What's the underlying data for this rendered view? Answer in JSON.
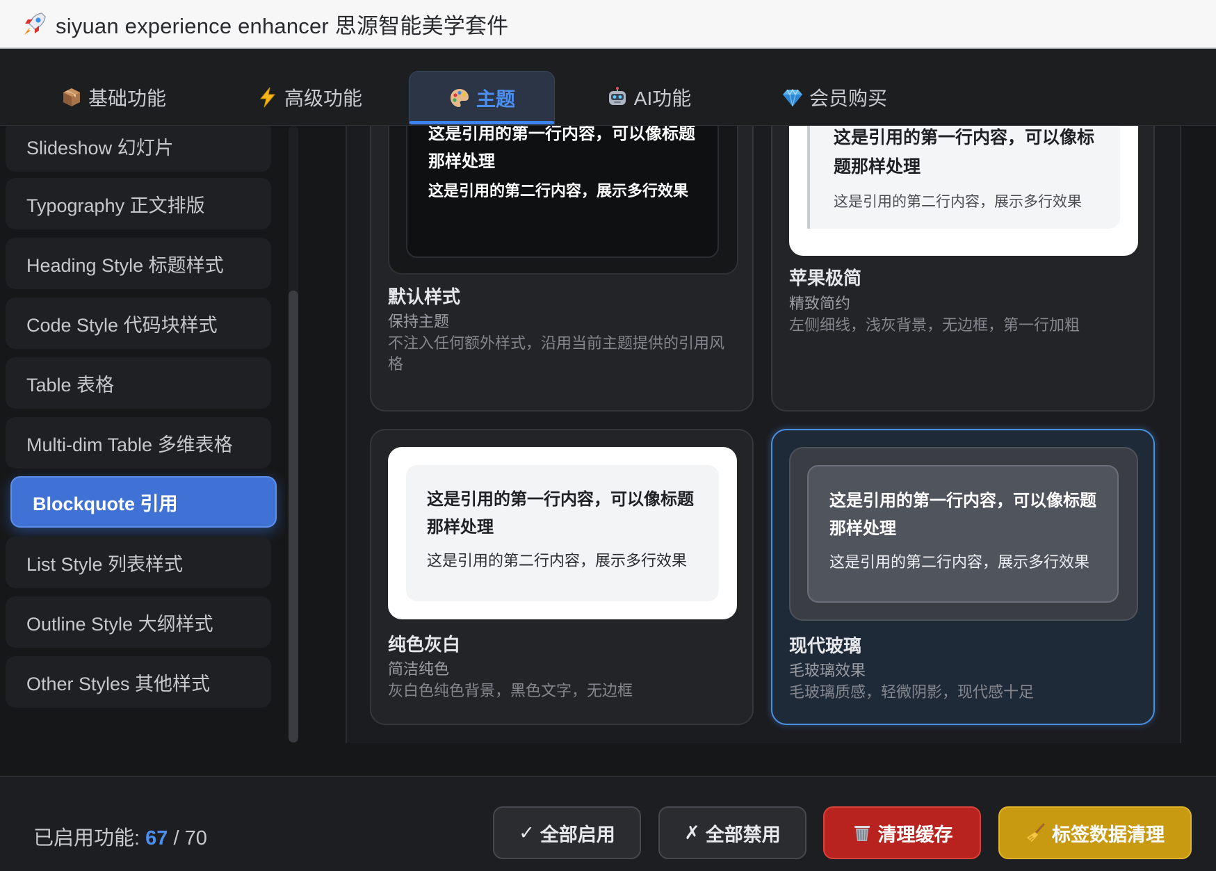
{
  "window": {
    "title": "siyuan experience enhancer 思源智能美学套件",
    "icon": "rocket-icon"
  },
  "tabs": [
    {
      "label": "基础功能",
      "icon": "package-icon",
      "active": false
    },
    {
      "label": "高级功能",
      "icon": "lightning-icon",
      "active": false
    },
    {
      "label": "主题",
      "icon": "palette-icon",
      "active": true
    },
    {
      "label": "AI功能",
      "icon": "robot-icon",
      "active": false
    },
    {
      "label": "会员购买",
      "icon": "diamond-icon",
      "active": false
    }
  ],
  "sidebar": {
    "items": [
      {
        "label": "Slideshow 幻灯片"
      },
      {
        "label": "Typography 正文排版"
      },
      {
        "label": "Heading Style 标题样式"
      },
      {
        "label": "Code Style 代码块样式"
      },
      {
        "label": "Table 表格"
      },
      {
        "label": "Multi-dim Table 多维表格"
      },
      {
        "label": "Blockquote 引用",
        "active": true
      },
      {
        "label": "List Style 列表样式"
      },
      {
        "label": "Outline Style 大纲样式"
      },
      {
        "label": "Other Styles 其他样式"
      }
    ]
  },
  "styles": [
    {
      "name": "默认样式",
      "subtitle": "保持主题",
      "description": "不注入任何额外样式，沿用当前主题提供的引用风格",
      "quote_line1": "这是引用的第一行内容，可以像标题那样处理",
      "quote_line2": "这是引用的第二行内容，展示多行效果",
      "selected": false
    },
    {
      "name": "苹果极简",
      "subtitle": "精致简约",
      "description": "左侧细线，浅灰背景，无边框，第一行加粗",
      "quote_line1": "这是引用的第一行内容，可以像标题那样处理",
      "quote_line2": "这是引用的第二行内容，展示多行效果",
      "selected": false
    },
    {
      "name": "纯色灰白",
      "subtitle": "简洁纯色",
      "description": "灰白色纯色背景，黑色文字，无边框",
      "quote_line1": "这是引用的第一行内容，可以像标题那样处理",
      "quote_line2": "这是引用的第二行内容，展示多行效果",
      "selected": false
    },
    {
      "name": "现代玻璃",
      "subtitle": "毛玻璃效果",
      "description": "毛玻璃质感，轻微阴影，现代感十足",
      "quote_line1": "这是引用的第一行内容，可以像标题那样处理",
      "quote_line2": "这是引用的第二行内容，展示多行效果",
      "selected": true
    }
  ],
  "footer": {
    "enabled_label": "已启用功能: ",
    "enabled_count": "67",
    "separator": " / ",
    "total_count": "70",
    "buttons": {
      "enable_all": "全部启用",
      "enable_all_icon": "✓",
      "disable_all": "全部禁用",
      "disable_all_icon": "✗",
      "clear_cache": "清理缓存",
      "clear_cache_icon": "wastebasket-icon",
      "tag_cleanup": "标签数据清理",
      "tag_cleanup_icon": "broom-icon"
    }
  },
  "colors": {
    "accent": "#3d84ee",
    "clear_cache_bg": "#b8231f",
    "tag_cleanup_bg": "#c79a12",
    "selected_border": "#4a8fe0"
  }
}
